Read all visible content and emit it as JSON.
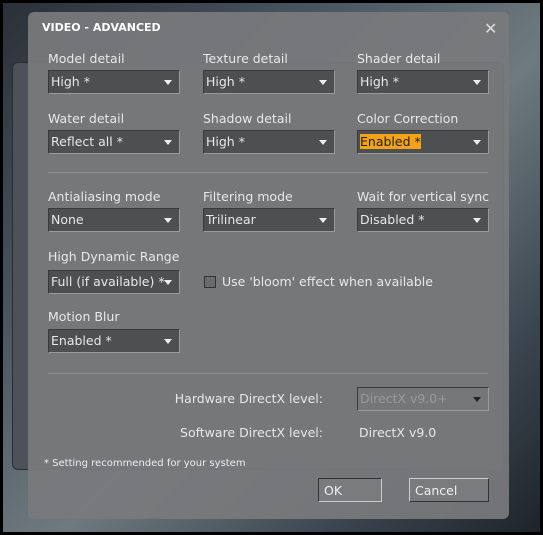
{
  "title": "VIDEO - ADVANCED",
  "close_icon": "close-icon",
  "accent_color": "#f5a21b",
  "fields": {
    "model": {
      "label": "Model detail",
      "value": "High *"
    },
    "texture": {
      "label": "Texture detail",
      "value": "High *"
    },
    "shader": {
      "label": "Shader detail",
      "value": "High *"
    },
    "water": {
      "label": "Water detail",
      "value": "Reflect all *"
    },
    "shadow": {
      "label": "Shadow detail",
      "value": "High *"
    },
    "color": {
      "label": "Color Correction",
      "value": "Enabled *"
    },
    "aa": {
      "label": "Antialiasing mode",
      "value": "None"
    },
    "filter": {
      "label": "Filtering mode",
      "value": "Trilinear"
    },
    "vsync": {
      "label": "Wait for vertical sync",
      "value": "Disabled *"
    },
    "hdr": {
      "label": "High Dynamic Range",
      "value": "Full (if available) *"
    },
    "bloom": {
      "label": "Use 'bloom' effect when available",
      "checked": false
    },
    "blur": {
      "label": "Motion Blur",
      "value": "Enabled *"
    },
    "hwdx": {
      "label": "Hardware DirectX level:",
      "value": "DirectX v9.0+",
      "disabled": true
    },
    "swdx": {
      "label": "Software DirectX level:",
      "value": "DirectX v9.0"
    }
  },
  "footnote": "* Setting recommended for your system",
  "buttons": {
    "ok": "OK",
    "cancel": "Cancel"
  }
}
